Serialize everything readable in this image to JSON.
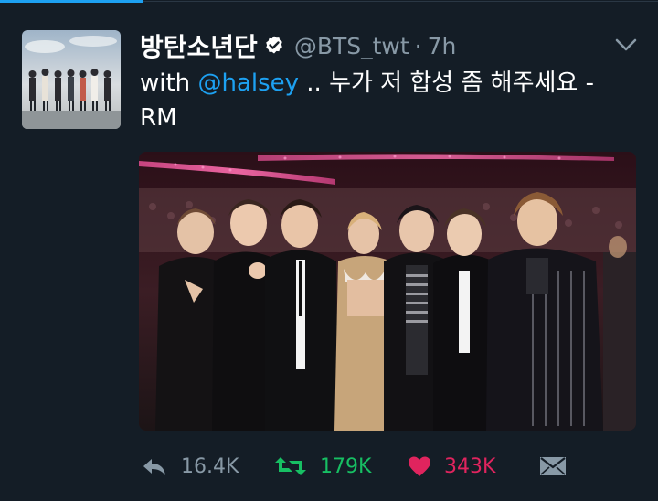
{
  "tweet": {
    "display_name": "방탄소년단",
    "handle": "@BTS_twt",
    "separator": "·",
    "time": "7h",
    "text_prefix": "with ",
    "mention": "@halsey",
    "text_suffix": " .. 누가 저 합성 좀 해주세요 - RM"
  },
  "actions": {
    "reply_count": "16.4K",
    "retweet_count": "179K",
    "like_count": "343K"
  },
  "colors": {
    "background": "#141d26",
    "link": "#1da1f2",
    "retweet": "#17bf63",
    "like": "#e0245e",
    "muted": "#8899a6"
  },
  "icons": {
    "reply": "reply-icon",
    "retweet": "retweet-icon",
    "like": "heart-icon",
    "message": "direct-message-icon",
    "verified": "verified-badge-icon",
    "menu": "chevron-down-icon"
  }
}
